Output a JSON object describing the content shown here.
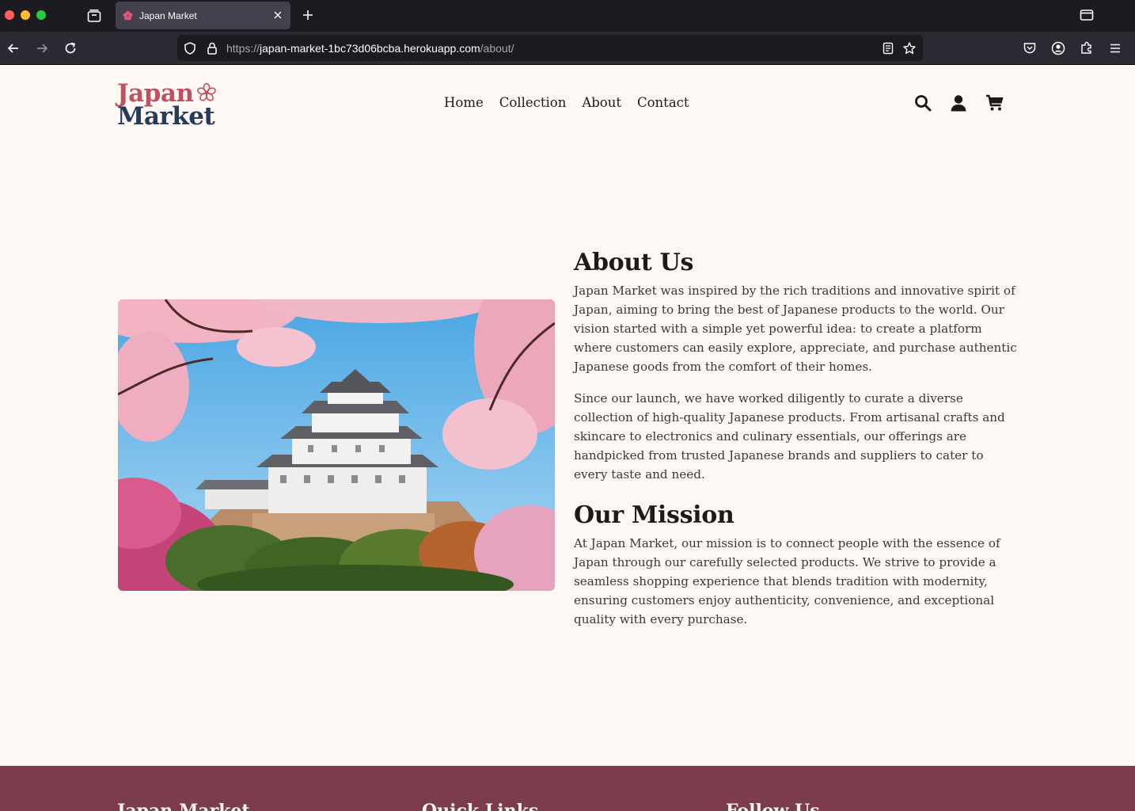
{
  "browser": {
    "tab_title": "Japan Market",
    "url_scheme": "https://",
    "url_host": "japan-market-1bc73d06bcba.herokuapp.com",
    "url_path": "/about/"
  },
  "site": {
    "logo_line1": "Japan",
    "logo_line2": "Market",
    "nav": {
      "home": "Home",
      "collection": "Collection",
      "about": "About",
      "contact": "Contact"
    }
  },
  "about": {
    "heading": "About Us",
    "paragraph1": "Japan Market was inspired by the rich traditions and innovative spirit of Japan, aiming to bring the best of Japanese products to the world. Our vision started with a simple yet powerful idea: to create a platform where customers can easily explore, appreciate, and purchase authentic Japanese goods from the comfort of their homes.",
    "paragraph2": "Since our launch, we have worked diligently to curate a diverse collection of high-quality Japanese products. From artisanal crafts and skincare to electronics and culinary essentials, our offerings are handpicked from trusted Japanese brands and suppliers to cater to every taste and need."
  },
  "mission": {
    "heading": "Our Mission",
    "paragraph": "At Japan Market, our mission is to connect people with the essence of Japan through our carefully selected products. We strive to provide a seamless shopping experience that blends tradition with modernity, ensuring customers enjoy authenticity, convenience, and exceptional quality with every purchase."
  },
  "footer": {
    "col1_title": "Japan Market",
    "col2_title": "Quick Links",
    "col3_title": "Follow Us"
  },
  "colors": {
    "page_bg": "#fdf8f4",
    "logo_pink": "#c0505f",
    "logo_navy": "#253b5a",
    "footer_bg": "#7b3d4b"
  }
}
